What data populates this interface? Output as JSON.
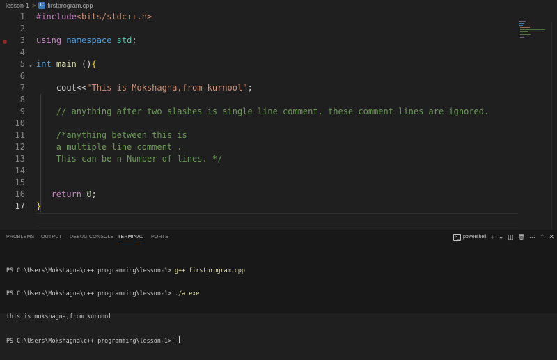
{
  "breadcrumb": {
    "folder": "lesson-1",
    "separator": ">",
    "file": "firstprogram.cpp",
    "file_icon": "C"
  },
  "editor": {
    "line_numbers": [
      "1",
      "2",
      "3",
      "4",
      "5",
      "6",
      "7",
      "8",
      "9",
      "10",
      "11",
      "12",
      "13",
      "14",
      "15",
      "16",
      "17"
    ],
    "lines": {
      "l1_directive": "#include",
      "l1_header": "<bits/stdc++.h>",
      "l3_using": "using",
      "l3_namespace": "namespace",
      "l3_std": "std",
      "l3_semi": ";",
      "l5_int": "int",
      "l5_main": "main",
      "l5_parens": " ()",
      "l5_brace": "{",
      "l7_cout": "cout",
      "l7_op": "<<",
      "l7_string": "\"This is Mokshagna,from kurnool\"",
      "l7_semi": ";",
      "l9_comment": "// anything after two slashes is single line comment. these comment lines are ignored.",
      "l11_comment": "/*anything between this is",
      "l12_comment": "a multiple line comment .",
      "l13_comment": "This can be n Number of lines. */",
      "l16_return": "return",
      "l16_zero": "0",
      "l16_semi": ";",
      "l17_brace": "}"
    },
    "fold_icon": "chevron-down-icon",
    "breakpoint_line": "2"
  },
  "panel": {
    "tabs": [
      "PROBLEMS",
      "OUTPUT",
      "DEBUG CONSOLE",
      "TERMINAL",
      "PORTS"
    ],
    "active_tab": "TERMINAL",
    "shell": "powershell",
    "tool_glyphs": {
      "add": "+",
      "dropdown": "⌄",
      "split": "◫",
      "trash": "🗑",
      "more": "···",
      "maximize": "⌃",
      "close": "✕"
    }
  },
  "terminal": {
    "prompt": "PS C:\\Users\\Mokshagna\\c++ programming\\lesson-1> ",
    "cmd1": "g++ firstprogram.cpp",
    "cmd2": "./a.exe",
    "output1": "this is mokshagna,from kurnool"
  },
  "colors": {
    "background": "#1f1f1f",
    "panel": "#181818",
    "accent": "#0078d4",
    "string": "#ce9178",
    "comment": "#6a9955",
    "keyword": "#569cd6"
  }
}
